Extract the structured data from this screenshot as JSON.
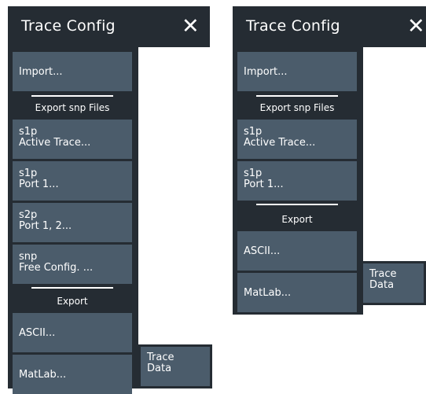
{
  "panels": [
    {
      "title": "Trace Config",
      "close_glyph": "✕",
      "items": [
        {
          "kind": "button",
          "lines": [
            "Import..."
          ]
        },
        {
          "kind": "separator",
          "label": "Export snp Files"
        },
        {
          "kind": "button",
          "lines": [
            "s1p",
            "Active Trace..."
          ]
        },
        {
          "kind": "button",
          "lines": [
            "s1p",
            "Port 1..."
          ]
        },
        {
          "kind": "button",
          "lines": [
            "s2p",
            "Port 1, 2..."
          ]
        },
        {
          "kind": "button",
          "lines": [
            "snp",
            "Free Config. ..."
          ]
        },
        {
          "kind": "separator",
          "label": "Export"
        },
        {
          "kind": "button",
          "lines": [
            "ASCII..."
          ]
        },
        {
          "kind": "button",
          "lines": [
            "MatLab..."
          ]
        }
      ],
      "flyout": {
        "lines": [
          "Trace",
          "Data"
        ]
      }
    },
    {
      "title": "Trace Config",
      "close_glyph": "✕",
      "items": [
        {
          "kind": "button",
          "lines": [
            "Import..."
          ]
        },
        {
          "kind": "separator",
          "label": "Export snp Files"
        },
        {
          "kind": "button",
          "lines": [
            "s1p",
            "Active Trace..."
          ]
        },
        {
          "kind": "button",
          "lines": [
            "s1p",
            "Port 1..."
          ]
        },
        {
          "kind": "separator",
          "label": "Export"
        },
        {
          "kind": "button",
          "lines": [
            "ASCII..."
          ]
        },
        {
          "kind": "button",
          "lines": [
            "MatLab..."
          ]
        }
      ],
      "flyout": {
        "lines": [
          "Trace",
          "Data"
        ]
      }
    }
  ]
}
